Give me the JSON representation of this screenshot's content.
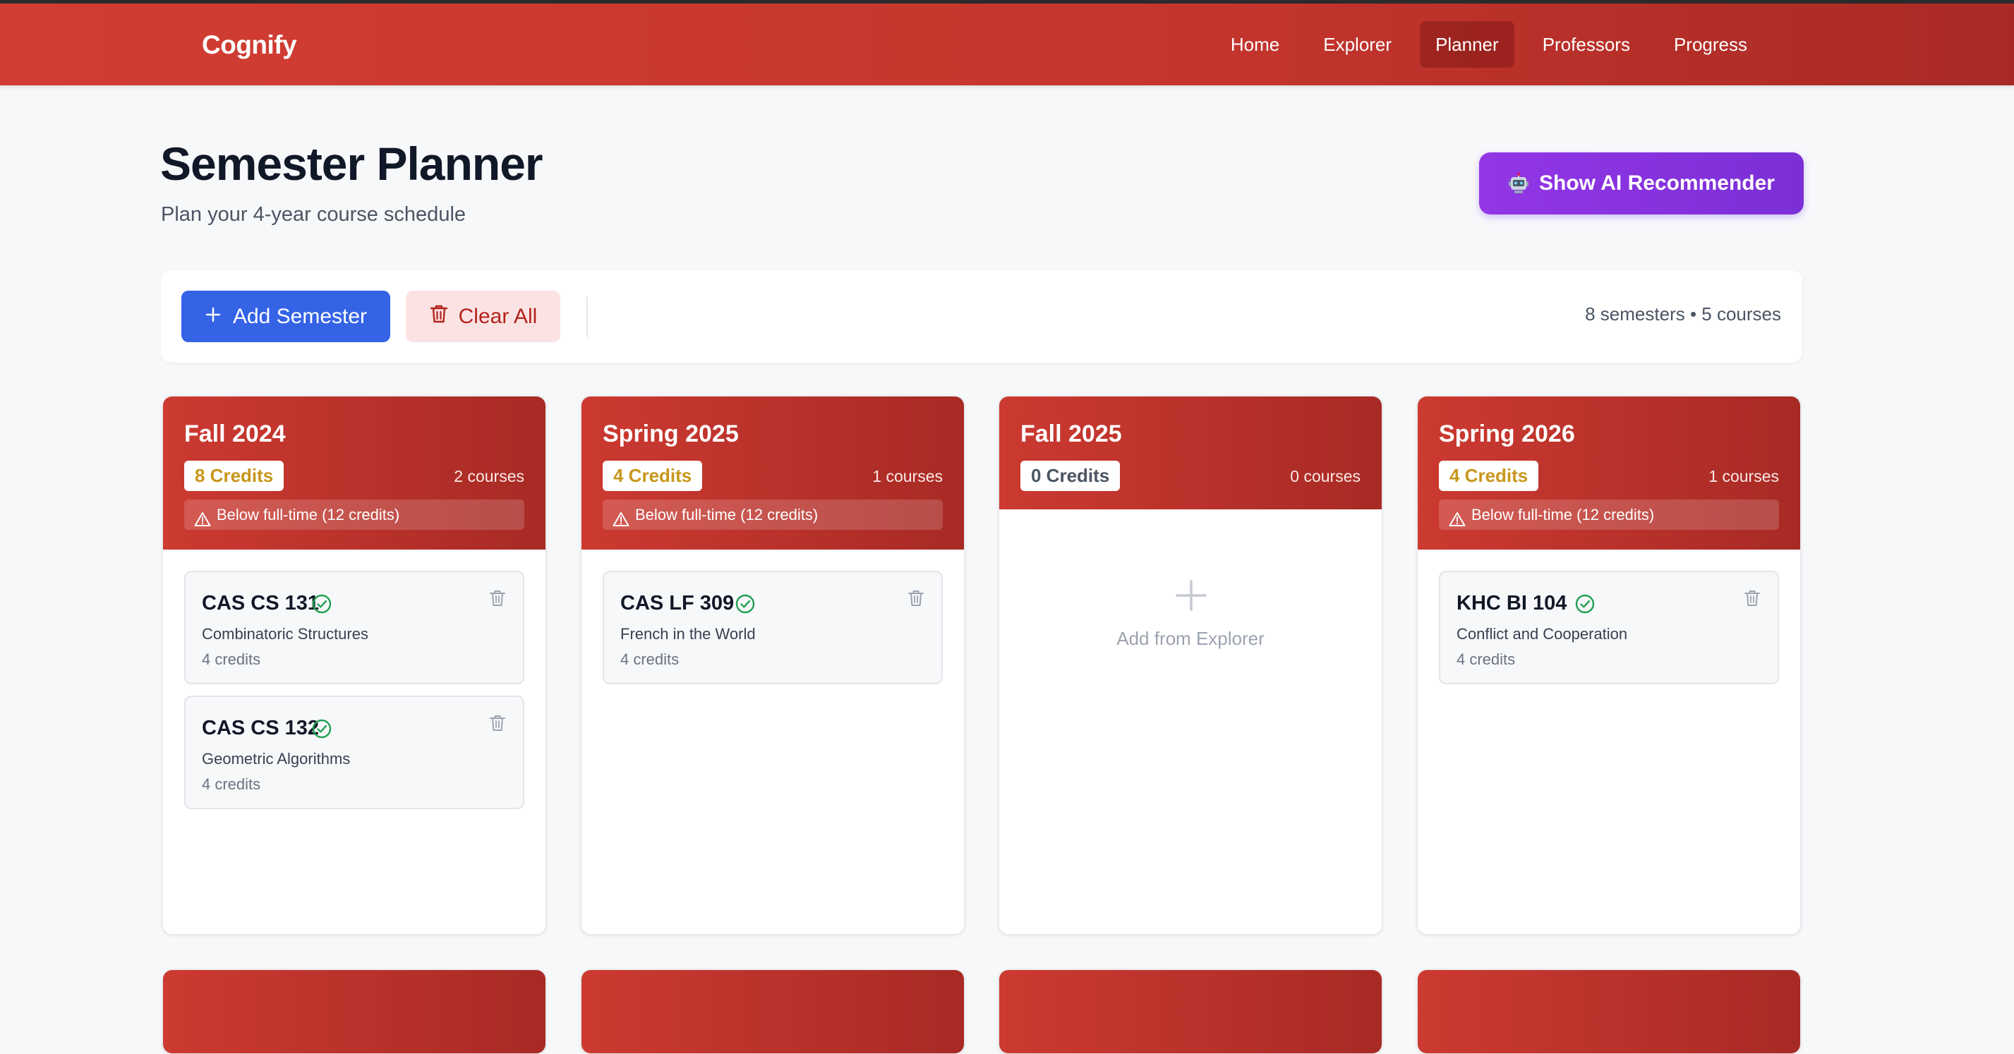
{
  "app": {
    "brand": "Cognify",
    "nav": [
      {
        "label": "Home",
        "active": false
      },
      {
        "label": "Explorer",
        "active": false
      },
      {
        "label": "Planner",
        "active": true
      },
      {
        "label": "Professors",
        "active": false
      },
      {
        "label": "Progress",
        "active": false
      }
    ]
  },
  "page": {
    "title": "Semester Planner",
    "subtitle": "Plan your 4-year course schedule",
    "ai_button_label": "Show AI Recommender",
    "ai_button_icon": "robot-icon"
  },
  "toolbar": {
    "add_semester_label": "Add Semester",
    "clear_all_label": "Clear All",
    "summary": "8 semesters • 5 courses"
  },
  "semesters": [
    {
      "name": "Fall 2024",
      "credits": "8 Credits",
      "course_count": "2 courses",
      "warning": "Below full-time (12 credits)",
      "courses": [
        {
          "code": "CAS CS 131",
          "title": "Combinatoric Structures",
          "credits": "4 credits"
        },
        {
          "code": "CAS CS 132",
          "title": "Geometric Algorithms",
          "credits": "4 credits"
        }
      ]
    },
    {
      "name": "Spring 2025",
      "credits": "4 Credits",
      "course_count": "1 courses",
      "warning": "Below full-time (12 credits)",
      "courses": [
        {
          "code": "CAS LF 309",
          "title": "French in the World",
          "credits": "4 credits"
        }
      ]
    },
    {
      "name": "Fall 2025",
      "credits": "0 Credits",
      "course_count": "0 courses",
      "warning": "",
      "empty_label": "Add from Explorer",
      "courses": []
    },
    {
      "name": "Spring 2026",
      "credits": "4 Credits",
      "course_count": "1 courses",
      "warning": "Below full-time (12 credits)",
      "courses": [
        {
          "code": "KHC BI 104",
          "title": "Conflict and Cooperation",
          "credits": "4 credits"
        }
      ]
    }
  ],
  "colors": {
    "brand_red": "#c4352d",
    "primary_blue": "#3463e6",
    "ai_purple": "#8b34e0",
    "warning_gold": "#c8961b",
    "check_green": "#22a052"
  }
}
